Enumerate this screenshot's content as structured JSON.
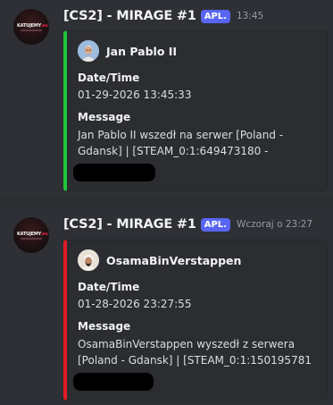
{
  "messages": [
    {
      "bot_name": "[CS2] - MIRAGE #1",
      "app_tag": "APL.",
      "timestamp": "13:45",
      "accent_color": "#22c53a",
      "avatar_icon": "server-logo-icon",
      "embed": {
        "author": "Jan Pablo II",
        "author_icon": "author-avatar-icon",
        "fields": [
          {
            "name": "Date/Time",
            "value": "01-29-2026 13:45:33"
          },
          {
            "name": "Message",
            "value_line1": "Jan Pablo II wszedł na serwer [Poland -",
            "value_line2": "Gdansk] | [STEAM_0:1:649473180 -"
          }
        ]
      }
    },
    {
      "bot_name": "[CS2] - MIRAGE #1",
      "app_tag": "APL.",
      "timestamp": "Wczoraj o 23:27",
      "accent_color": "#e01b24",
      "avatar_icon": "server-logo-icon",
      "embed": {
        "author": "OsamaBinVerstappen",
        "author_icon": "author-avatar-icon",
        "fields": [
          {
            "name": "Date/Time",
            "value": "01-28-2026 23:27:55"
          },
          {
            "name": "Message",
            "value_line1": "OsamaBinVerstappen wyszedł z serwera",
            "value_line2": "[Poland - Gdansk] | [STEAM_0:1:150195781 -"
          }
        ]
      }
    }
  ]
}
